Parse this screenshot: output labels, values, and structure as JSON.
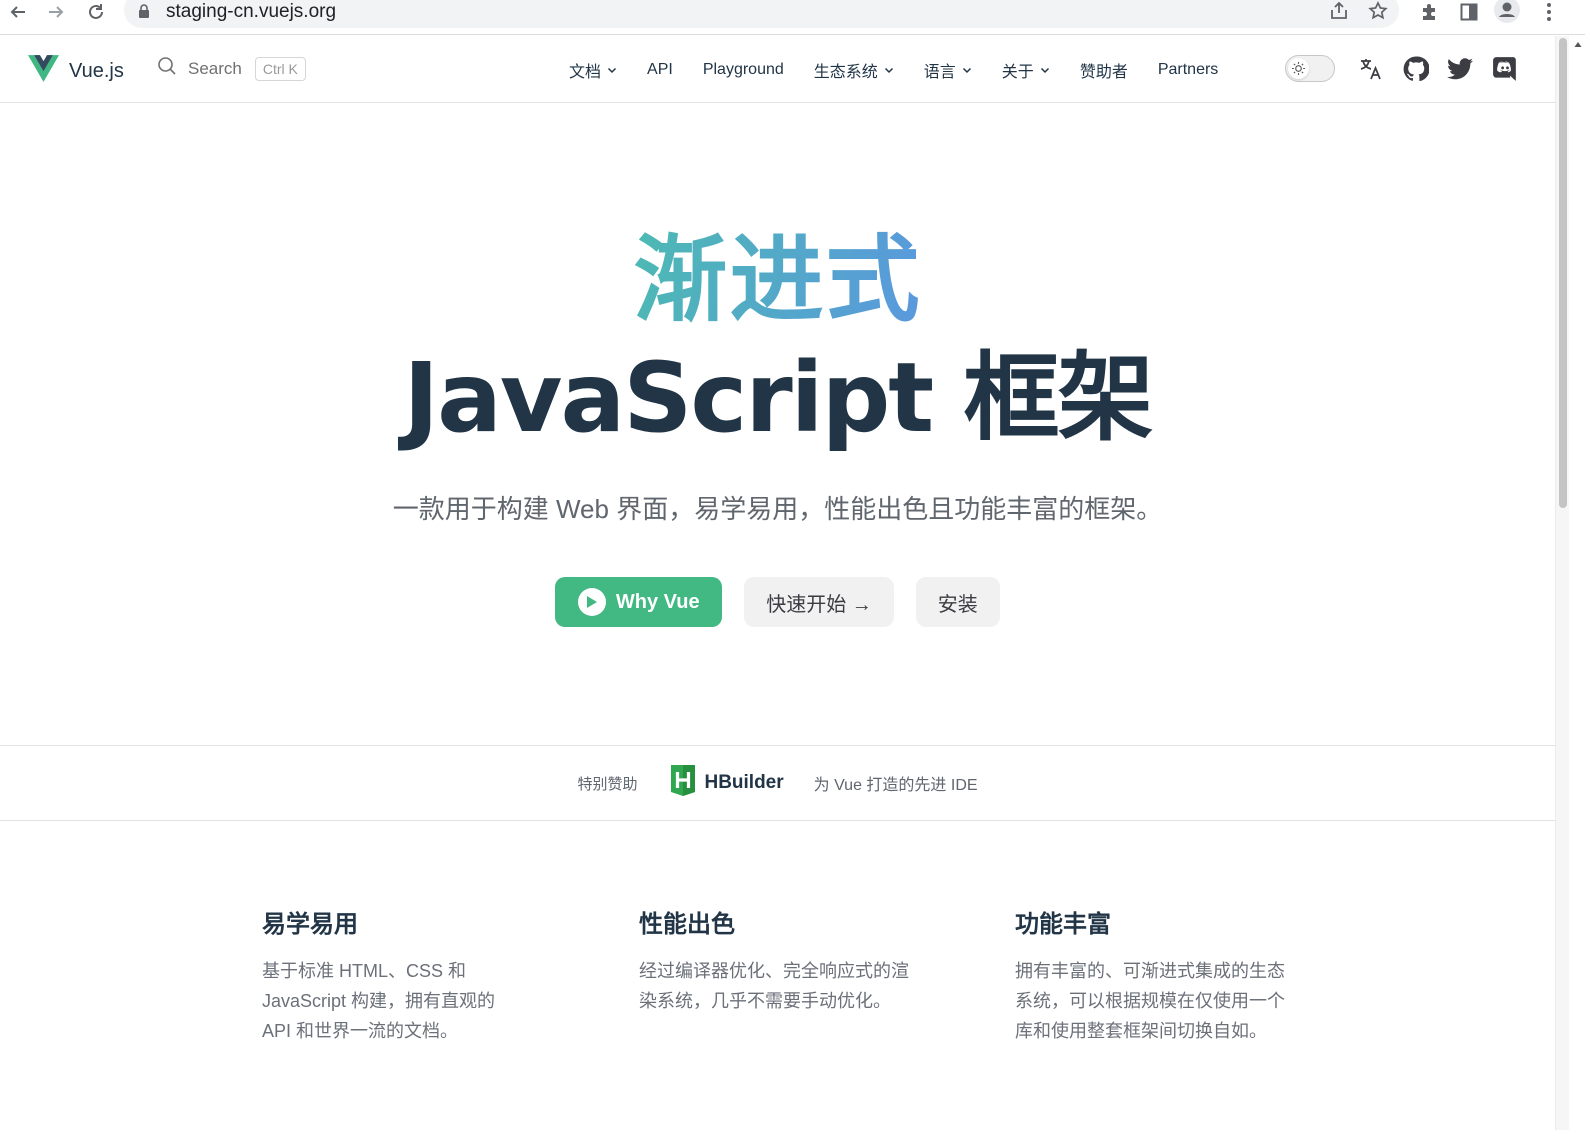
{
  "browser": {
    "url": "staging-cn.vuejs.org"
  },
  "header": {
    "logo_text": "Vue.js",
    "search_label": "Search",
    "search_shortcut": "Ctrl K",
    "menu": [
      {
        "label": "文档",
        "dropdown": true
      },
      {
        "label": "API",
        "dropdown": false
      },
      {
        "label": "Playground",
        "dropdown": false
      },
      {
        "label": "生态系统",
        "dropdown": true
      },
      {
        "label": "语言",
        "dropdown": true
      },
      {
        "label": "关于",
        "dropdown": true
      },
      {
        "label": "赞助者",
        "dropdown": false
      },
      {
        "label": "Partners",
        "dropdown": false
      }
    ],
    "icons": [
      "translate-icon",
      "github-icon",
      "twitter-icon",
      "discord-icon"
    ]
  },
  "hero": {
    "accent": "渐进式",
    "title": "JavaScript 框架",
    "tagline": "一款用于构建 Web 界面，易学易用，性能出色且功能丰富的框架。",
    "primary_label": "Why Vue",
    "secondary_label": "快速开始 →",
    "tertiary_label": "安装"
  },
  "sponsor": {
    "label": "特别赞助",
    "name": "HBuilder",
    "description": "为 Vue 打造的先进 IDE"
  },
  "features": [
    {
      "title": "易学易用",
      "text": "基于标准 HTML、CSS 和 JavaScript 构建，拥有直观的 API 和世界一流的文档。"
    },
    {
      "title": "性能出色",
      "text": "经过编译器优化、完全响应式的渲染系统，几乎不需要手动优化。"
    },
    {
      "title": "功能丰富",
      "text": "拥有丰富的、可渐进式集成的生态系统，可以根据规模在仅使用一个库和使用整套框架间切换自如。"
    }
  ],
  "colors": {
    "brand": "#42b883",
    "accent_gradient_start": "#42d392",
    "accent_gradient_end": "#647eff",
    "text": "#213547"
  }
}
